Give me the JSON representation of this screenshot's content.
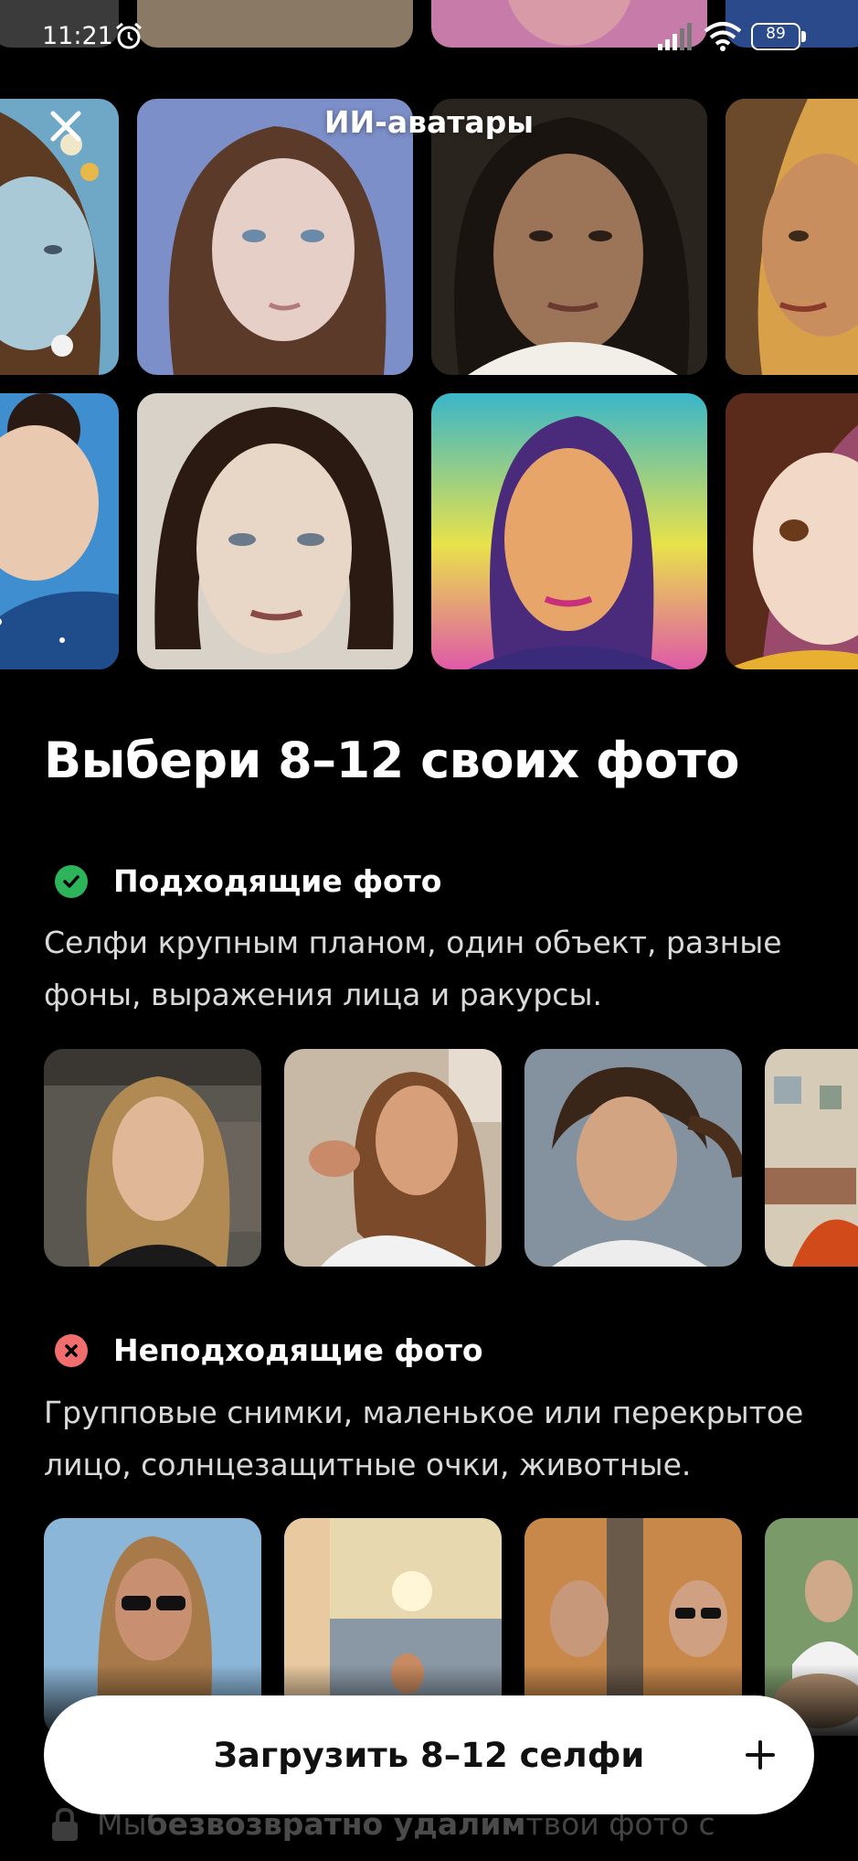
{
  "status_bar": {
    "time": "11:21",
    "battery": "89"
  },
  "header": {
    "title": "ИИ-аватары"
  },
  "main": {
    "title": "Выбери 8–12 своих фото"
  },
  "good": {
    "title": "Подходящие фото",
    "description": "Селфи крупным планом, один объект, разные фоны, выражения лица и ракурсы."
  },
  "bad": {
    "title": "Неподходящие фото",
    "description": "Групповые снимки, маленькое или перекрытое лицо, солнцезащитные очки, животные."
  },
  "cta": {
    "label": "Загрузить 8–12 селфи"
  },
  "footer": {
    "prefix": "Мы ",
    "bold": "безвозвратно удалим",
    "suffix": " твои фото с"
  },
  "colors": {
    "good_badge": "#2db35a",
    "bad_badge": "#f26d6d",
    "cta_bg": "#ffffff",
    "background": "#000000"
  },
  "icons": [
    "close-icon",
    "alarm-icon",
    "signal-icon",
    "wifi-icon",
    "battery-icon",
    "check-icon",
    "cross-icon",
    "plus-icon",
    "lock-icon"
  ]
}
